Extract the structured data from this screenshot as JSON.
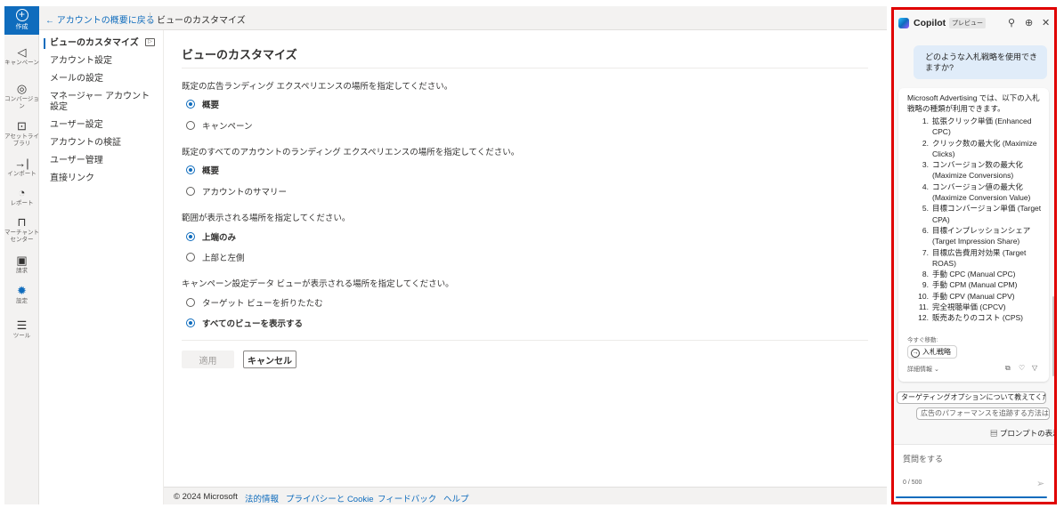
{
  "rail": {
    "create": "作成",
    "items": [
      {
        "label": "キャンペーン",
        "icon": "megaphone-icon"
      },
      {
        "label": "コンバージョン",
        "icon": "target-icon"
      },
      {
        "label": "アセットライブラリ",
        "icon": "image-icon"
      },
      {
        "label": "インポート",
        "icon": "import-icon"
      },
      {
        "label": "レポート",
        "icon": "report-icon"
      },
      {
        "label": "マーチャントセンター",
        "icon": "bag-icon"
      },
      {
        "label": "請求",
        "icon": "billing-icon"
      },
      {
        "label": "設定",
        "icon": "gear-icon"
      },
      {
        "label": "ツール",
        "icon": "tools-icon"
      }
    ]
  },
  "topbar": {
    "back": "← アカウントの概要に戻る",
    "title": "ビューのカスタマイズ"
  },
  "subnav": {
    "items": [
      "ビューのカスタマイズ",
      "アカウント設定",
      "メールの設定",
      "マネージャー アカウント設定",
      "ユーザー設定",
      "アカウントの検証",
      "ユーザー管理",
      "直接リンク"
    ]
  },
  "main": {
    "heading": "ビューのカスタマイズ",
    "sections": [
      {
        "question": "既定の広告ランディング エクスペリエンスの場所を指定してください。",
        "options": [
          "概要",
          "キャンペーン"
        ],
        "selected": 0
      },
      {
        "question": "既定のすべてのアカウントのランディング エクスペリエンスの場所を指定してください。",
        "options": [
          "概要",
          "アカウントのサマリー"
        ],
        "selected": 0
      },
      {
        "question": "範囲が表示される場所を指定してください。",
        "options": [
          "上端のみ",
          "上部と左側"
        ],
        "selected": 0
      },
      {
        "question": "キャンペーン設定データ ビューが表示される場所を指定してください。",
        "options": [
          "ターゲット ビューを折りたたむ",
          "すべてのビューを表示する"
        ],
        "selected": 1
      }
    ],
    "apply": "適用",
    "cancel": "キャンセル"
  },
  "footer": {
    "copyright": "© 2024 Microsoft",
    "links": [
      "法的情報",
      "プライバシーと Cookie",
      "フィードバック",
      "ヘルプ"
    ]
  },
  "copilot": {
    "title": "Copilot",
    "badge": "プレビュー",
    "user_message": "どのような入札戦略を使用できますか?",
    "intro": "Microsoft Advertising では、以下の入札戦略の種類が利用できます。",
    "strategies": [
      "拡張クリック単価 (Enhanced CPC)",
      "クリック数の最大化 (Maximize Clicks)",
      "コンバージョン数の最大化 (Maximize Conversions)",
      "コンバージョン値の最大化 (Maximize Conversion Value)",
      "目標コンバージョン単価 (Target CPA)",
      "目標インプレッションシェア (Target Impression Share)",
      "目標広告費用対効果 (Target ROAS)",
      "手動 CPC (Manual CPC)",
      "手動 CPM (Manual CPM)",
      "手動 CPV (Manual CPV)",
      "完全視聴単価 (CPCV)",
      "販売あたりのコスト (CPS)"
    ],
    "goto_label": "今すぐ移動:",
    "goto_button": "入札戦略",
    "details": "詳細情報",
    "suggestions": [
      "ターゲティングオプションについて教えてくだ...",
      "広告のパフォーマンスを追跡する方法は?"
    ],
    "prompt_library": "プロンプトの表示",
    "input_placeholder": "質問をする",
    "char_count": "0 / 500",
    "accent": "#0f6cbd",
    "highlight_border": "#e00000"
  }
}
